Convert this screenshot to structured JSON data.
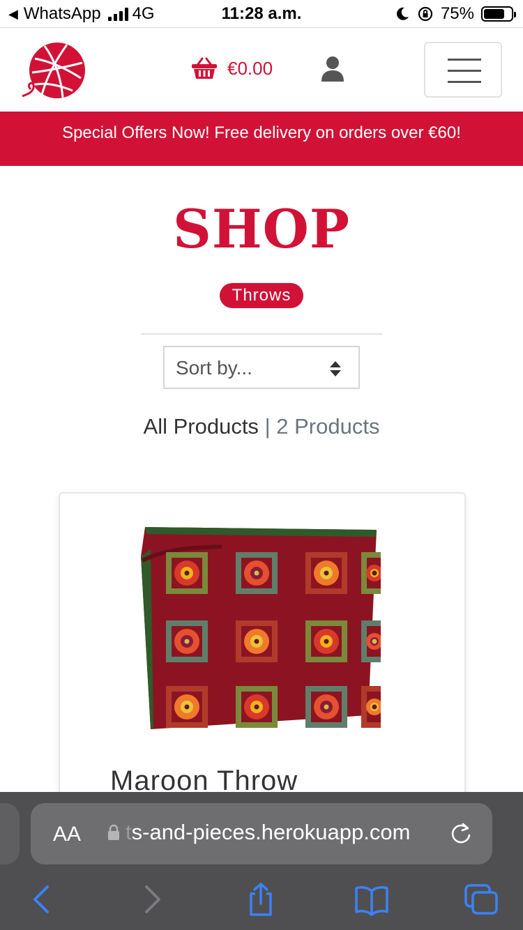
{
  "status_bar": {
    "back_app": "WhatsApp",
    "network": "4G",
    "time": "11:28 a.m.",
    "battery": "75%",
    "battery_level": 0.75
  },
  "header": {
    "basket_total": "€0.00",
    "icons": [
      "yarn-ball-logo",
      "basket-icon",
      "user-icon",
      "hamburger-menu-icon"
    ]
  },
  "promo": {
    "text": "Special Offers Now! Free delivery on orders over €60!"
  },
  "shop": {
    "title": "SHOP",
    "category_badge": "Throws",
    "sort_placeholder": "Sort by...",
    "all_products_label": "All Products",
    "separator": "|",
    "product_count": "2 Products"
  },
  "products": [
    {
      "name": "Maroon Throw"
    }
  ],
  "browser": {
    "text_size_label": "AA",
    "url_faded": "t",
    "url": "s-and-pieces.herokuapp.com"
  },
  "colors": {
    "brand_red": "#d11236",
    "browser_bar": "#4f4f52",
    "ios_blue": "#3b82f6"
  }
}
